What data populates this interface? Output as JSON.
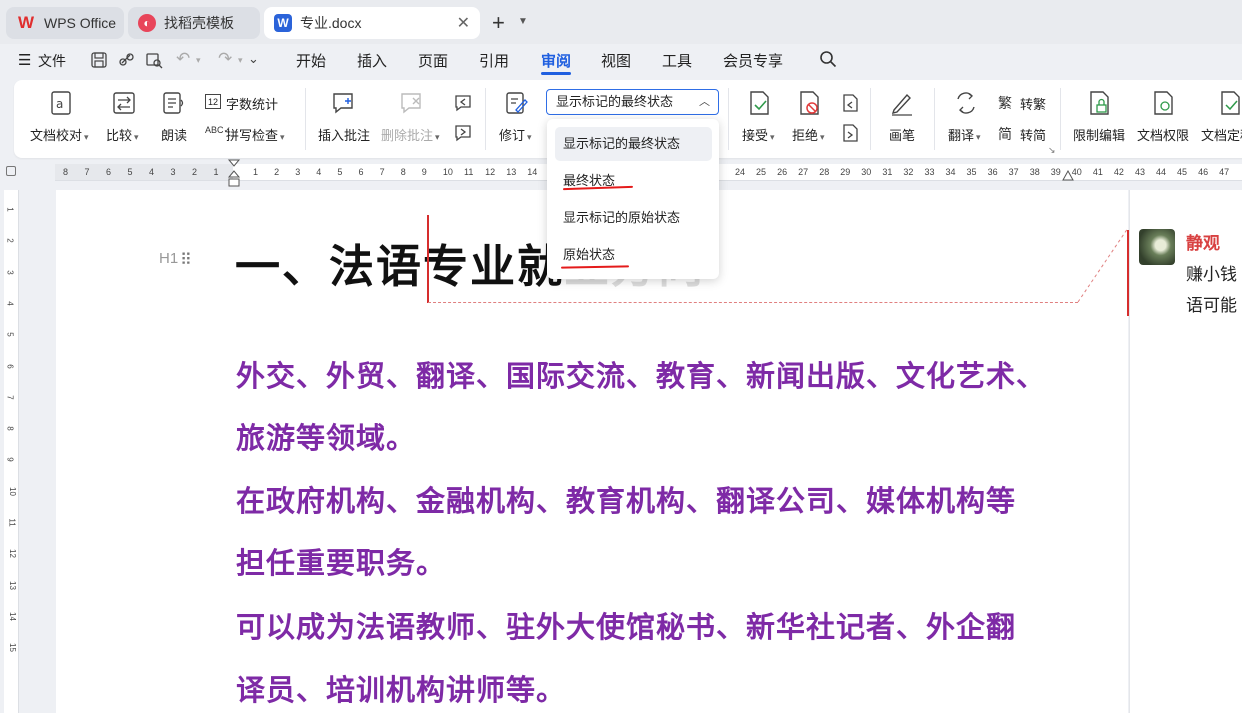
{
  "tabs": [
    {
      "label": "WPS Office",
      "icon": "wps-logo-icon"
    },
    {
      "label": "找稻壳模板",
      "icon": "template-icon"
    },
    {
      "label": "专业.docx",
      "icon": "word-doc-icon",
      "active": true
    }
  ],
  "menu": {
    "file_label": "文件",
    "items": [
      "开始",
      "插入",
      "页面",
      "引用",
      "审阅",
      "视图",
      "工具",
      "会员专享"
    ],
    "active": "审阅"
  },
  "ribbon": {
    "proofread": "文档校对",
    "compare": "比较",
    "read_aloud": "朗读",
    "word_count": "字数统计",
    "spell_check": "拼写检查",
    "insert_comment": "插入批注",
    "delete_comment": "删除批注",
    "track_changes": "修订",
    "state_selected": "显示标记的最终状态",
    "accept": "接受",
    "reject": "拒绝",
    "pen": "画笔",
    "translate": "翻译",
    "to_traditional": "转繁",
    "to_simplified": "转简",
    "restrict_edit": "限制编辑",
    "doc_permission": "文档权限",
    "doc_final": "文档定稿"
  },
  "dropdown": {
    "options": [
      "显示标记的最终状态",
      "最终状态",
      "显示标记的原始状态",
      "原始状态"
    ],
    "highlighted": 0
  },
  "ruler": {
    "left_numbers": [
      "8",
      "7",
      "6",
      "5",
      "4",
      "3",
      "2",
      "1"
    ],
    "right_numbers": [
      "1",
      "2",
      "3",
      "4",
      "5",
      "6",
      "7",
      "8",
      "9",
      "10",
      "11",
      "12",
      "13",
      "14",
      "24",
      "25",
      "26",
      "27",
      "28",
      "29",
      "30",
      "31",
      "32",
      "33",
      "34",
      "35",
      "36",
      "37",
      "38",
      "39",
      "40",
      "41",
      "42",
      "43",
      "44",
      "45",
      "46",
      "47"
    ],
    "vertical_numbers": [
      "1",
      "2",
      "3",
      "4",
      "5",
      "6",
      "7",
      "8",
      "9",
      "10",
      "11",
      "12",
      "13",
      "14",
      "15"
    ]
  },
  "document": {
    "heading": "一、法语专业就",
    "heading_tail": "业方向",
    "paragraphs": [
      "外交、外贸、翻译、国际交流、教育、新闻出版、文化艺术、",
      "旅游等领域。",
      "在政府机构、金融机构、教育机构、翻译公司、媒体机构等",
      "担任重要职务。",
      "可以成为法语教师、驻外大使馆秘书、新华社记者、外企翻",
      "译员、培训机构讲师等。"
    ],
    "heading_style_mark": "H1"
  },
  "comment": {
    "author": "静观",
    "lines": [
      "赚小钱",
      "语可能"
    ]
  },
  "colors": {
    "accent": "#1f5fe0",
    "paragraph_text": "#7e2aa6",
    "revision_red": "#d62d2d",
    "comment_author": "#d84141"
  }
}
